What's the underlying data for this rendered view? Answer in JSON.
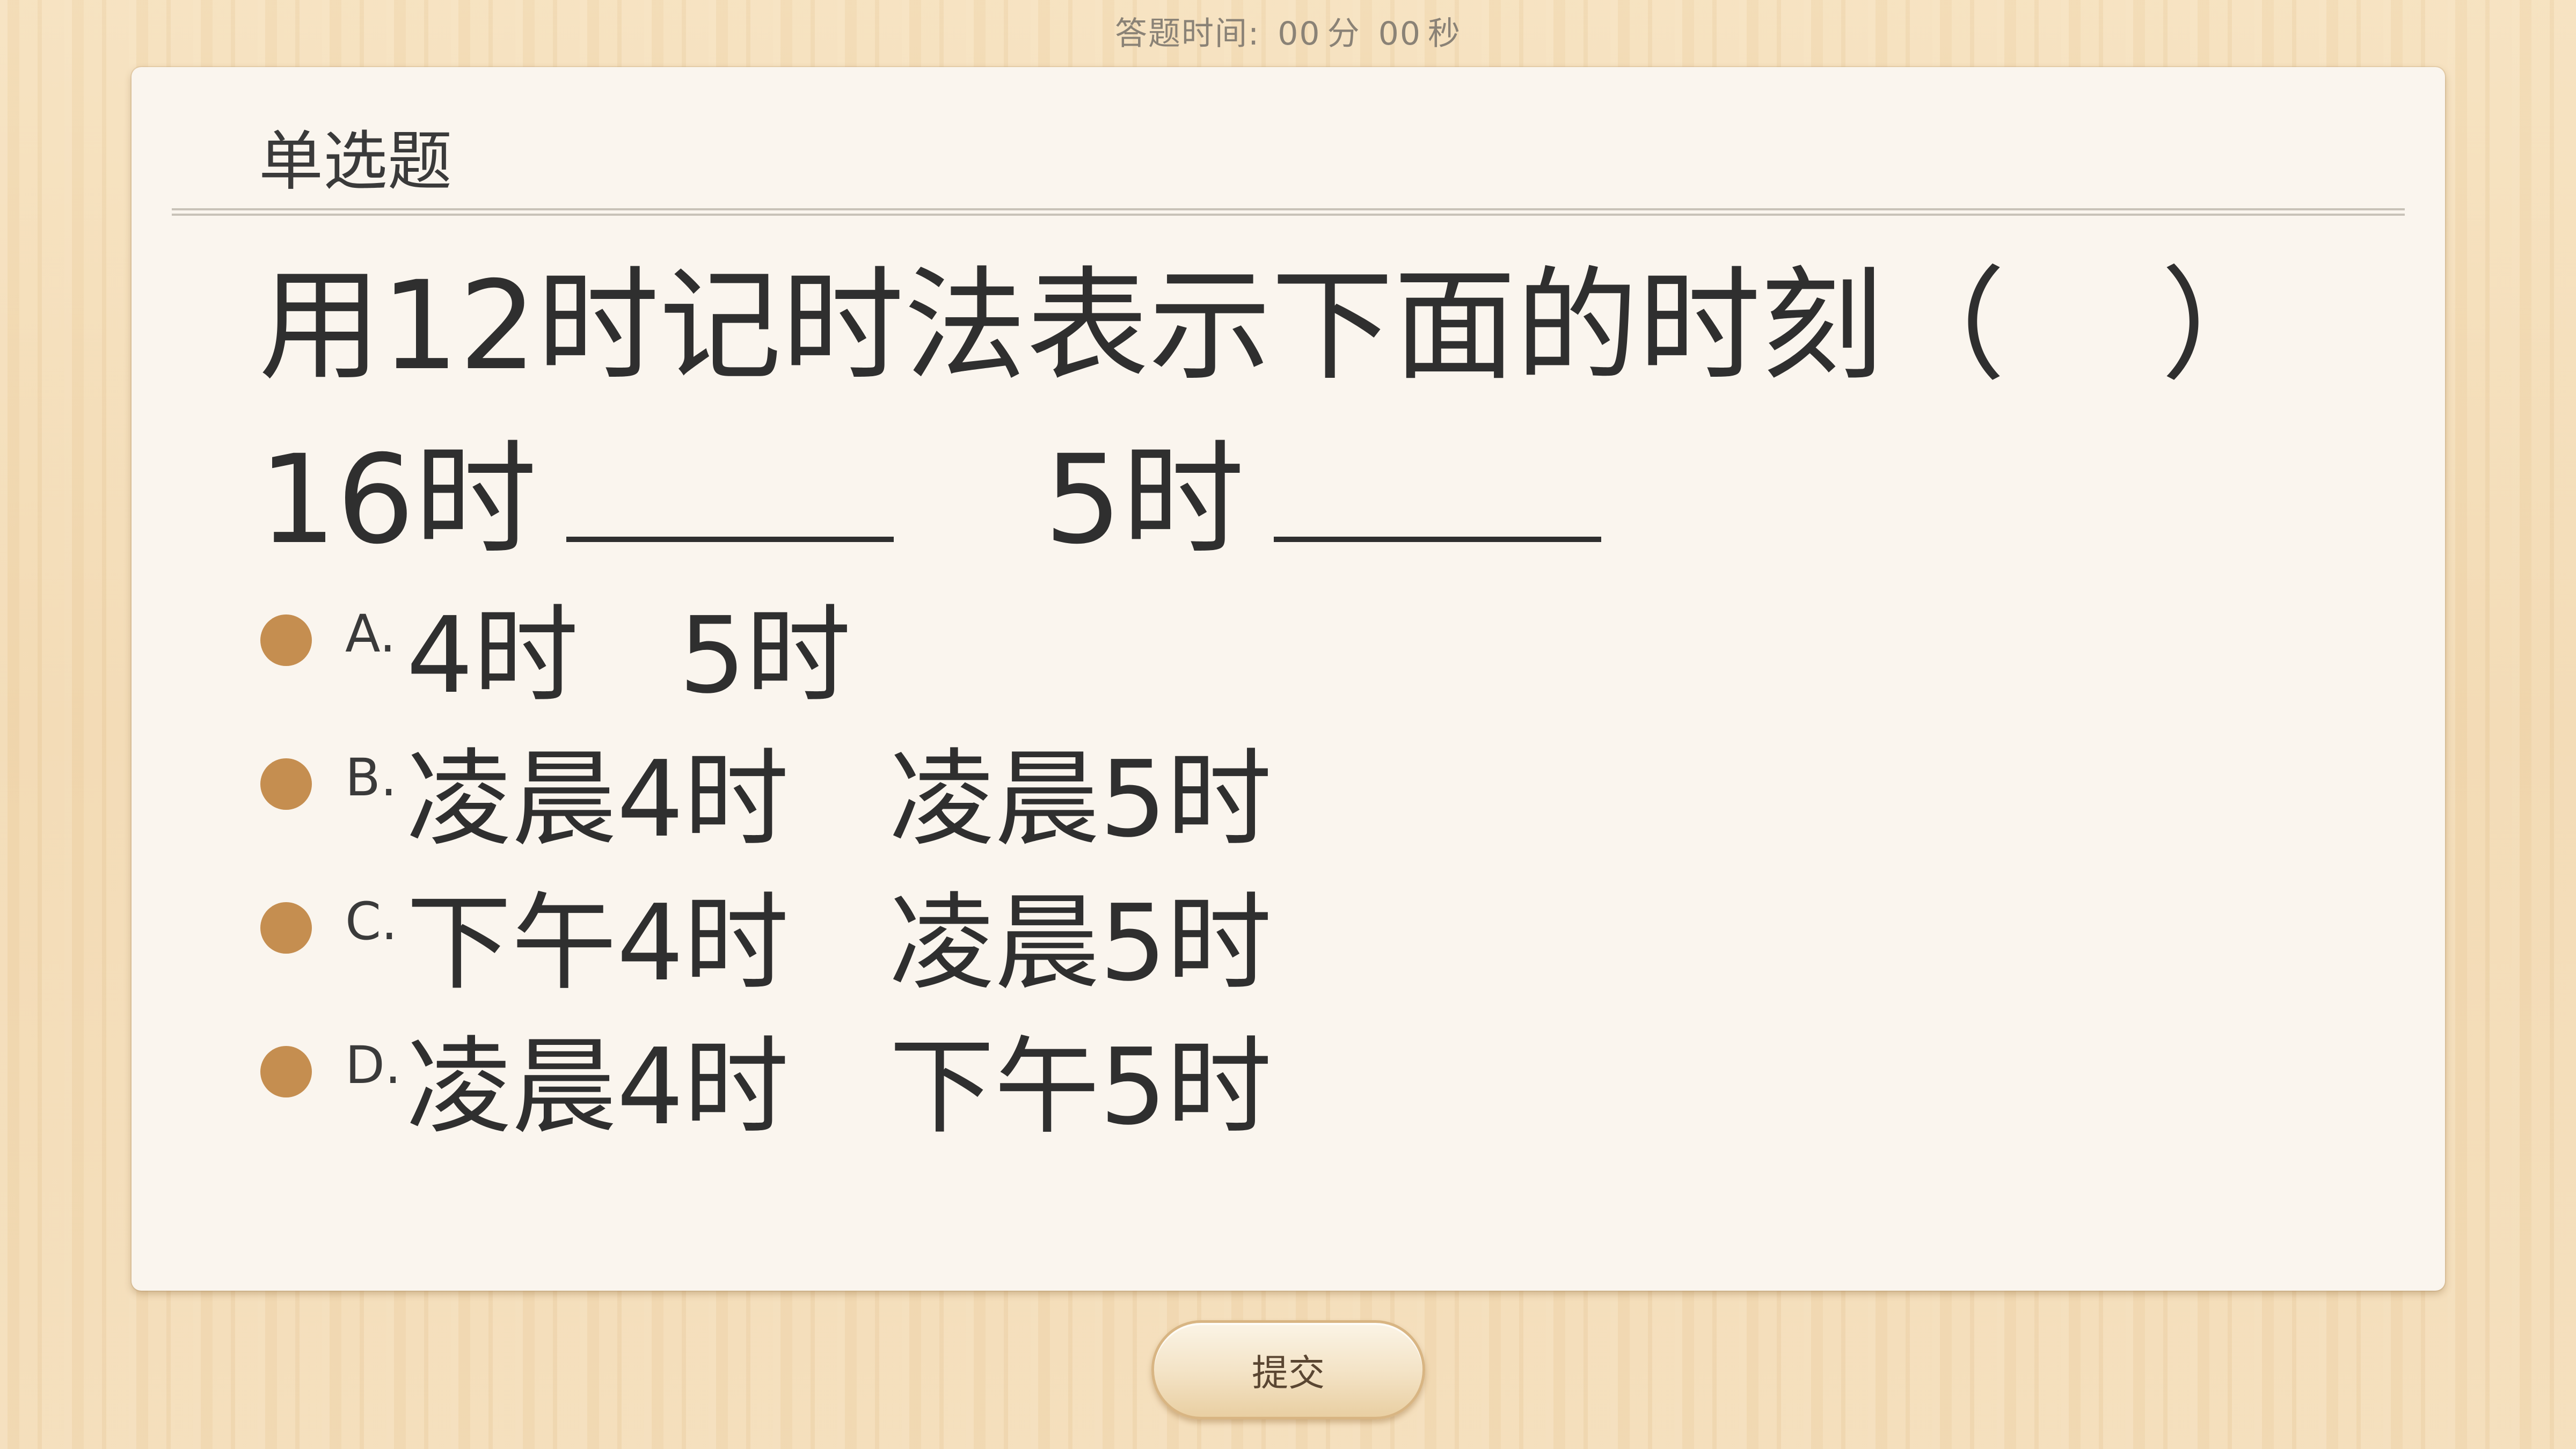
{
  "timer": {
    "label": "答题时间:",
    "minutes": "00",
    "minutes_unit": "分",
    "seconds": "00",
    "seconds_unit": "秒"
  },
  "question": {
    "type": "单选题",
    "stem_line1": "用12时记时法表示下面的时刻（    ）",
    "stem_line2_part1": "16时",
    "stem_line2_part2": "5时",
    "options": [
      {
        "letter": "A.",
        "text": "4时   5时"
      },
      {
        "letter": "B.",
        "text": "凌晨4时   凌晨5时"
      },
      {
        "letter": "C.",
        "text": "下午4时   凌晨5时"
      },
      {
        "letter": "D.",
        "text": "凌晨4时   下午5时"
      }
    ]
  },
  "submit": {
    "label": "提交"
  },
  "colors": {
    "accent_dot": "#c58e50",
    "card_bg": "#faf5ee",
    "wood_bg": "#f3dcb6"
  }
}
